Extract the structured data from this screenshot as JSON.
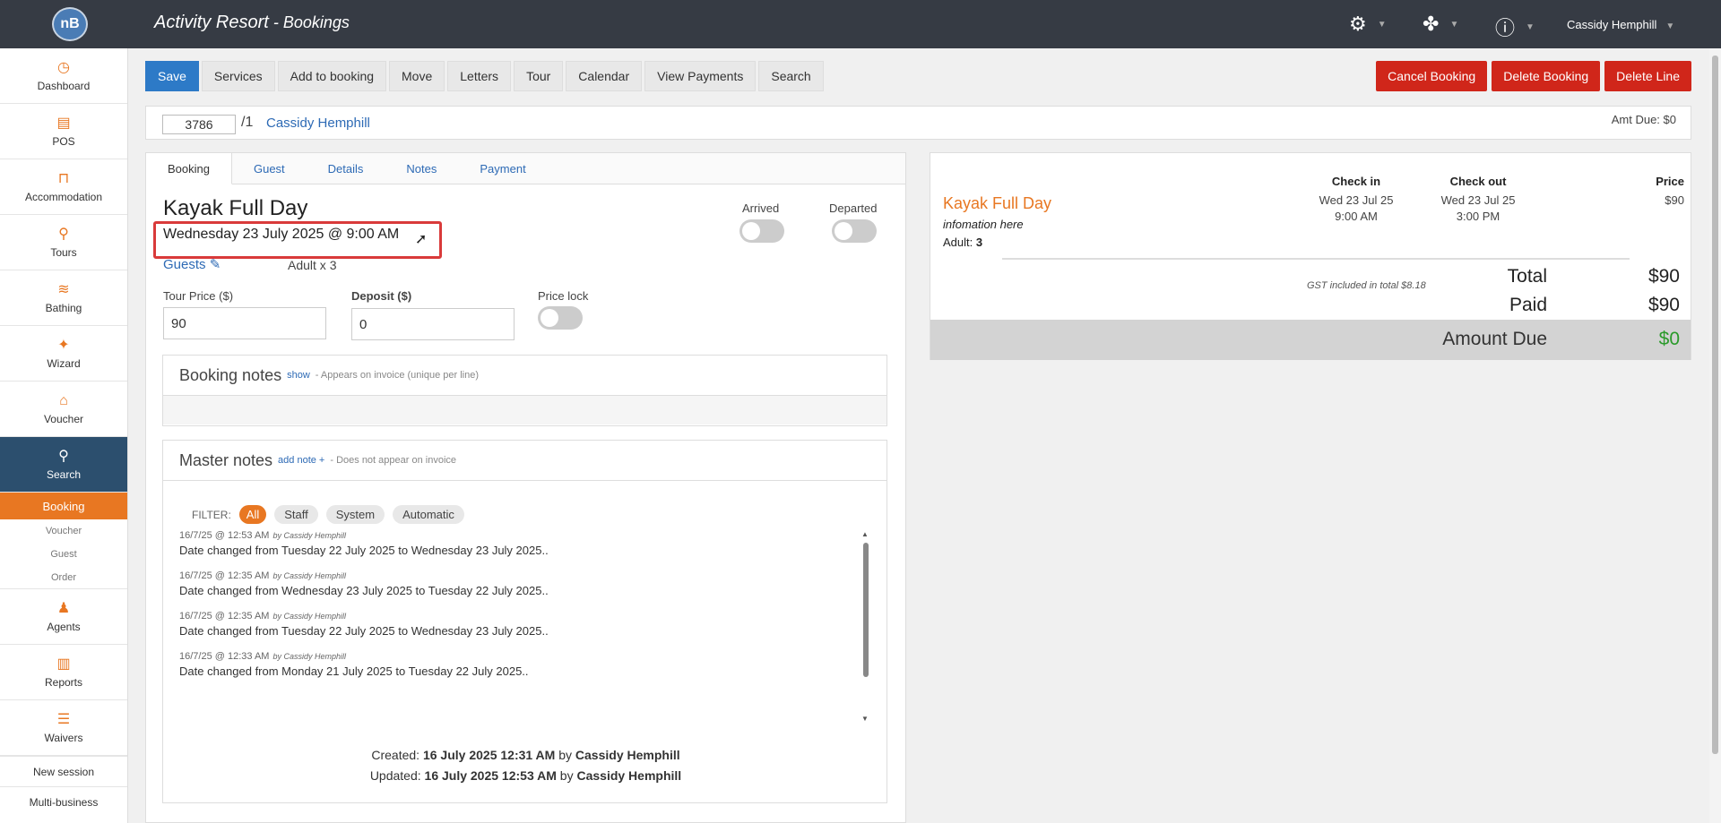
{
  "header": {
    "logo_text": "nB",
    "app_name": "Activity Resort",
    "separator": " - ",
    "page_name": "Bookings",
    "user_name": "Cassidy Hemphill",
    "icons": [
      "settings-gears-icon",
      "fan-icon",
      "help-circle-icon"
    ]
  },
  "sidebar": {
    "items": [
      {
        "label": "Dashboard",
        "icon": "dashboard-icon",
        "glyph": "◷"
      },
      {
        "label": "POS",
        "icon": "register-icon",
        "glyph": "▤"
      },
      {
        "label": "Accommodation",
        "icon": "bed-icon",
        "glyph": "⊓"
      },
      {
        "label": "Tours",
        "icon": "route-icon",
        "glyph": "⚲"
      },
      {
        "label": "Bathing",
        "icon": "waves-icon",
        "glyph": "≋"
      },
      {
        "label": "Wizard",
        "icon": "wand-icon",
        "glyph": "✦"
      },
      {
        "label": "Voucher",
        "icon": "gift-icon",
        "glyph": "⌂"
      }
    ],
    "search": {
      "label": "Search",
      "glyph": "⚲"
    },
    "search_sub": {
      "active": "Booking",
      "items": [
        "Voucher",
        "Guest",
        "Order"
      ]
    },
    "lower_items": [
      {
        "label": "Agents",
        "icon": "users-icon",
        "glyph": "♟"
      },
      {
        "label": "Reports",
        "icon": "report-icon",
        "glyph": "▥"
      },
      {
        "label": "Waivers",
        "icon": "checklist-icon",
        "glyph": "☰"
      }
    ],
    "text_items": [
      "New session",
      "Multi-business"
    ]
  },
  "toolbar": {
    "save": "Save",
    "buttons": [
      "Services",
      "Add to booking",
      "Move",
      "Letters",
      "Tour",
      "Calendar",
      "View Payments",
      "Search"
    ],
    "danger_buttons": [
      "Cancel Booking",
      "Delete Booking",
      "Delete Line"
    ]
  },
  "booking_bar": {
    "number": "3786",
    "suffix": "/1",
    "guest_name": "Cassidy Hemphill",
    "amount_due": "Amt Due: $0"
  },
  "tabs": [
    "Booking",
    "Guest",
    "Details",
    "Notes",
    "Payment"
  ],
  "service": {
    "title": "Kayak Full Day",
    "datetime": "Wednesday 23 July 2025 @ 9:00 AM",
    "guests_label": "Guests",
    "guests_value": "Adult x 3",
    "arrived_label": "Arrived",
    "departed_label": "Departed",
    "arrived": false,
    "departed": false
  },
  "fields": {
    "tour_price_label": "Tour Price ($)",
    "tour_price": "90",
    "deposit_label": "Deposit ($)",
    "deposit": "0",
    "price_lock_label": "Price lock",
    "price_lock": false
  },
  "booking_notes": {
    "title": "Booking notes",
    "link": "show",
    "desc": "- Appears on invoice (unique per line)"
  },
  "master_notes": {
    "title": "Master notes",
    "link": "add note +",
    "desc": "- Does not appear on invoice",
    "filter_label": "FILTER:",
    "filters": [
      "All",
      "Staff",
      "System",
      "Automatic"
    ],
    "active_filter": "All",
    "notes": [
      {
        "time": "16/7/25 @ 12:53 AM",
        "by": "by Cassidy Hemphill",
        "text": "Date changed from Tuesday 22 July 2025 to Wednesday 23 July 2025.."
      },
      {
        "time": "16/7/25 @ 12:35 AM",
        "by": "by Cassidy Hemphill",
        "text": "Date changed from Wednesday 23 July 2025 to Tuesday 22 July 2025.."
      },
      {
        "time": "16/7/25 @ 12:35 AM",
        "by": "by Cassidy Hemphill",
        "text": "Date changed from Tuesday 22 July 2025 to Wednesday 23 July 2025.."
      },
      {
        "time": "16/7/25 @ 12:33 AM",
        "by": "by Cassidy Hemphill",
        "text": "Date changed from Monday 21 July 2025 to Tuesday 22 July 2025.."
      }
    ],
    "created_label": "Created:",
    "created_date": "16 July 2025 12:31 AM",
    "created_by_label": "by",
    "created_by": "Cassidy Hemphill",
    "updated_label": "Updated:",
    "updated_date": "16 July 2025 12:53 AM",
    "updated_by_label": "by",
    "updated_by": "Cassidy Hemphill"
  },
  "summary": {
    "col_checkin": "Check in",
    "col_checkout": "Check out",
    "col_price": "Price",
    "service_name": "Kayak Full Day",
    "service_info": "infomation here",
    "adult_label": "Adult:",
    "adult_count": "3",
    "checkin_date": "Wed 23 Jul 25",
    "checkin_time": "9:00 AM",
    "checkout_date": "Wed 23 Jul 25",
    "checkout_time": "3:00 PM",
    "price": "$90",
    "gst_note": "GST included in total $8.18",
    "total_label": "Total",
    "total": "$90",
    "paid_label": "Paid",
    "paid": "$90",
    "due_label": "Amount Due",
    "due": "$0",
    "due_color": "#2a9a2a"
  },
  "colors": {
    "accent": "#e87722",
    "primary": "#2d7ac7",
    "danger": "#d0261a",
    "topbar": "#363b44",
    "active_nav": "#2c4f6e",
    "highlight": "#d93a3a"
  }
}
